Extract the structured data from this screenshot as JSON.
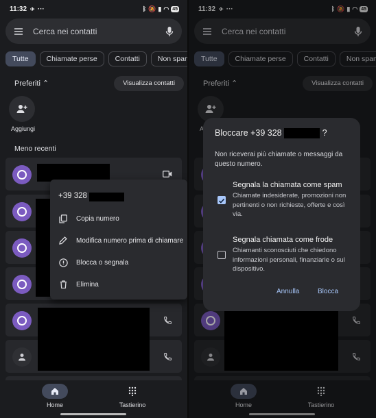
{
  "status": {
    "time": "11:32",
    "battery": "45"
  },
  "search": {
    "placeholder": "Cerca nei contatti"
  },
  "chips": [
    "Tutte",
    "Chiamate perse",
    "Contatti",
    "Non spam"
  ],
  "favorites": {
    "label": "Preferiti",
    "view_button": "Visualizza contatti",
    "add_label": "Aggiungi"
  },
  "recent_label": "Meno recenti",
  "nav": {
    "home": "Home",
    "keypad": "Tastierino"
  },
  "context_menu": {
    "number": "+39 328",
    "items": [
      "Copia numero",
      "Modifica numero prima di chiamare",
      "Blocca o segnala",
      "Elimina"
    ]
  },
  "dialog": {
    "title_prefix": "Bloccare +39 328",
    "title_suffix": "?",
    "message": "Non riceverai più chiamate o messaggi da questo numero.",
    "option1_title": "Segnala la chiamata come spam",
    "option1_desc": "Chiamate indesiderate, promozioni non pertinenti o non richieste, offerte e così via.",
    "option1_checked": true,
    "option2_title": "Segnala chiamata come frode",
    "option2_desc": "Chiamanti sconosciuti che chiedono informazioni personali, finanziarie o sul dispositivo.",
    "option2_checked": false,
    "cancel": "Annulla",
    "confirm": "Blocca"
  },
  "colors": {
    "accent": "#a8c7fa",
    "avatar": "#7b5bc0",
    "chip_selected": "#434a5c"
  }
}
